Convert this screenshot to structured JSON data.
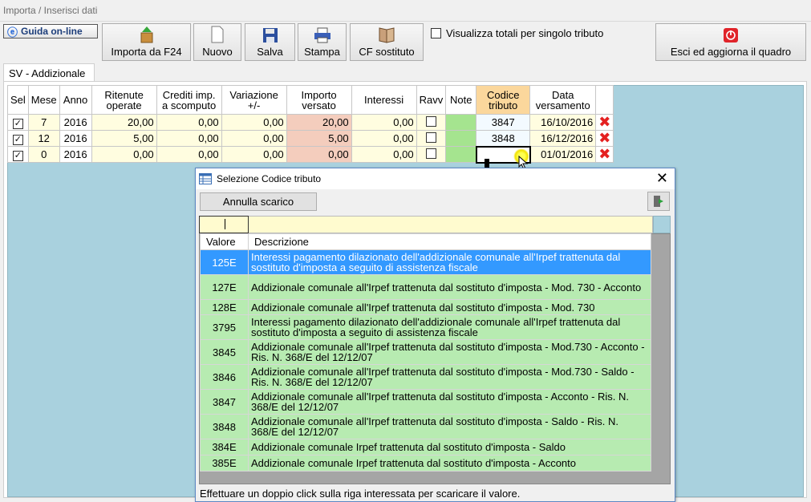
{
  "breadcrumb": "Importa / Inserisci dati",
  "toolbar": {
    "guida": "Guida on-line",
    "importa": "Importa da F24",
    "nuovo": "Nuovo",
    "salva": "Salva",
    "stampa": "Stampa",
    "cf": "CF sostituto",
    "totali": "Visualizza totali per singolo tributo",
    "esci": "Esci ed aggiorna il quadro"
  },
  "tab": "SV - Addizionale",
  "grid": {
    "headers": {
      "sel": "Sel",
      "mese": "Mese",
      "anno": "Anno",
      "ritenute_1": "Ritenute",
      "ritenute_2": "operate",
      "crediti_1": "Crediti imp.",
      "crediti_2": "a scomputo",
      "variazione_1": "Variazione",
      "variazione_2": "+/-",
      "importo_1": "Importo",
      "importo_2": "versato",
      "interessi": "Interessi",
      "ravv": "Ravv",
      "note": "Note",
      "codice_1": "Codice",
      "codice_2": "tributo",
      "data_1": "Data",
      "data_2": "versamento"
    },
    "rows": [
      {
        "mese": "7",
        "anno": "2016",
        "ritenute": "20,00",
        "crediti": "0,00",
        "variazione": "0,00",
        "importo": "20,00",
        "interessi": "0,00",
        "codice": "3847",
        "data": "16/10/2016"
      },
      {
        "mese": "12",
        "anno": "2016",
        "ritenute": "5,00",
        "crediti": "0,00",
        "variazione": "0,00",
        "importo": "5,00",
        "interessi": "0,00",
        "codice": "3848",
        "data": "16/12/2016"
      },
      {
        "mese": "0",
        "anno": "2016",
        "ritenute": "0,00",
        "crediti": "0,00",
        "variazione": "0,00",
        "importo": "0,00",
        "interessi": "0,00",
        "codice": "",
        "data": "01/01/2016"
      }
    ]
  },
  "dialog": {
    "title": "Selezione Codice tributo",
    "annulla": "Annulla scarico",
    "col_valore": "Valore",
    "col_descrizione": "Descrizione",
    "items": [
      {
        "valore": "125E",
        "descrizione": "Interessi pagamento dilazionato dell'addizionale comunale all'Irpef trattenuta dal sostituto d'imposta a seguito di assistenza fiscale"
      },
      {
        "valore": "127E",
        "descrizione": "Addizionale comunale all'Irpef trattenuta dal sostituto d'imposta - Mod. 730 - Acconto"
      },
      {
        "valore": "128E",
        "descrizione": "Addizionale comunale all'Irpef trattenuta dal sostituto d'imposta - Mod. 730"
      },
      {
        "valore": "3795",
        "descrizione": "Interessi pagamento dilazionato dell'addizionale comunale all'Irpef trattenuta dal sostituto d'imposta a seguito di assistenza fiscale"
      },
      {
        "valore": "3845",
        "descrizione": "Addizionale comunale all'Irpef trattenuta dal sostituto d'imposta - Mod.730 - Acconto - Ris. N. 368/E del 12/12/07"
      },
      {
        "valore": "3846",
        "descrizione": "Addizionale comunale all'Irpef trattenuta dal sostituto d'imposta - Mod.730 - Saldo - Ris. N. 368/E del 12/12/07"
      },
      {
        "valore": "3847",
        "descrizione": "Addizionale comunale all'Irpef trattenuta dal sostituto d'imposta - Acconto - Ris. N. 368/E del 12/12/07"
      },
      {
        "valore": "3848",
        "descrizione": "Addizionale comunale all'Irpef trattenuta dal sostituto d'imposta - Saldo - Ris. N. 368/E del 12/12/07"
      },
      {
        "valore": "384E",
        "descrizione": "Addizionale comunale Irpef trattenuta dal sostituto d'imposta - Saldo"
      },
      {
        "valore": "385E",
        "descrizione": "Addizionale comunale Irpef trattenuta dal sostituto d'imposta - Acconto"
      }
    ],
    "footer": "Effettuare un doppio click sulla riga interessata per scaricare il valore."
  }
}
